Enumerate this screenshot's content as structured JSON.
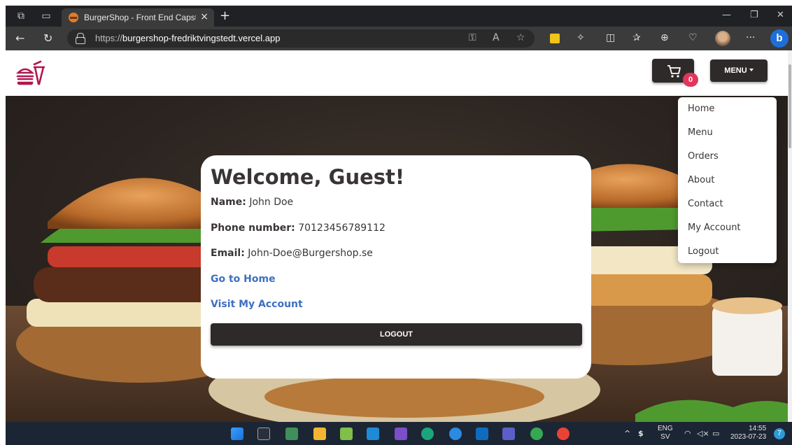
{
  "browser": {
    "tab_title": "BurgerShop - Front End Capston",
    "tab_close": "×",
    "new_tab": "+",
    "url_prefix": "https://",
    "url_host": "burgershop-fredriktvingstedt.vercel.app"
  },
  "header": {
    "cart_count": "0",
    "menu_label": "MENU"
  },
  "dropdown": {
    "items": [
      "Home",
      "Menu",
      "Orders",
      "About",
      "Contact",
      "My Account",
      "Logout"
    ]
  },
  "card": {
    "title": "Welcome, Guest!",
    "name_label": "Name:",
    "name_value": "John Doe",
    "phone_label": "Phone number:",
    "phone_value": "70123456789112",
    "email_label": "Email:",
    "email_value": "John-Doe@Burgershop.se",
    "link_home": "Go to Home",
    "link_account": "Visit My Account",
    "logout_label": "LOGOUT"
  },
  "taskbar": {
    "lang_top": "ENG",
    "lang_bottom": "SV",
    "time": "14:55",
    "date": "2023-07-23",
    "notifications": "7"
  },
  "colors": {
    "accent_dark": "#2f2a2a",
    "badge": "#e0365c",
    "link": "#3e6fc1",
    "logo": "#b0174e"
  }
}
